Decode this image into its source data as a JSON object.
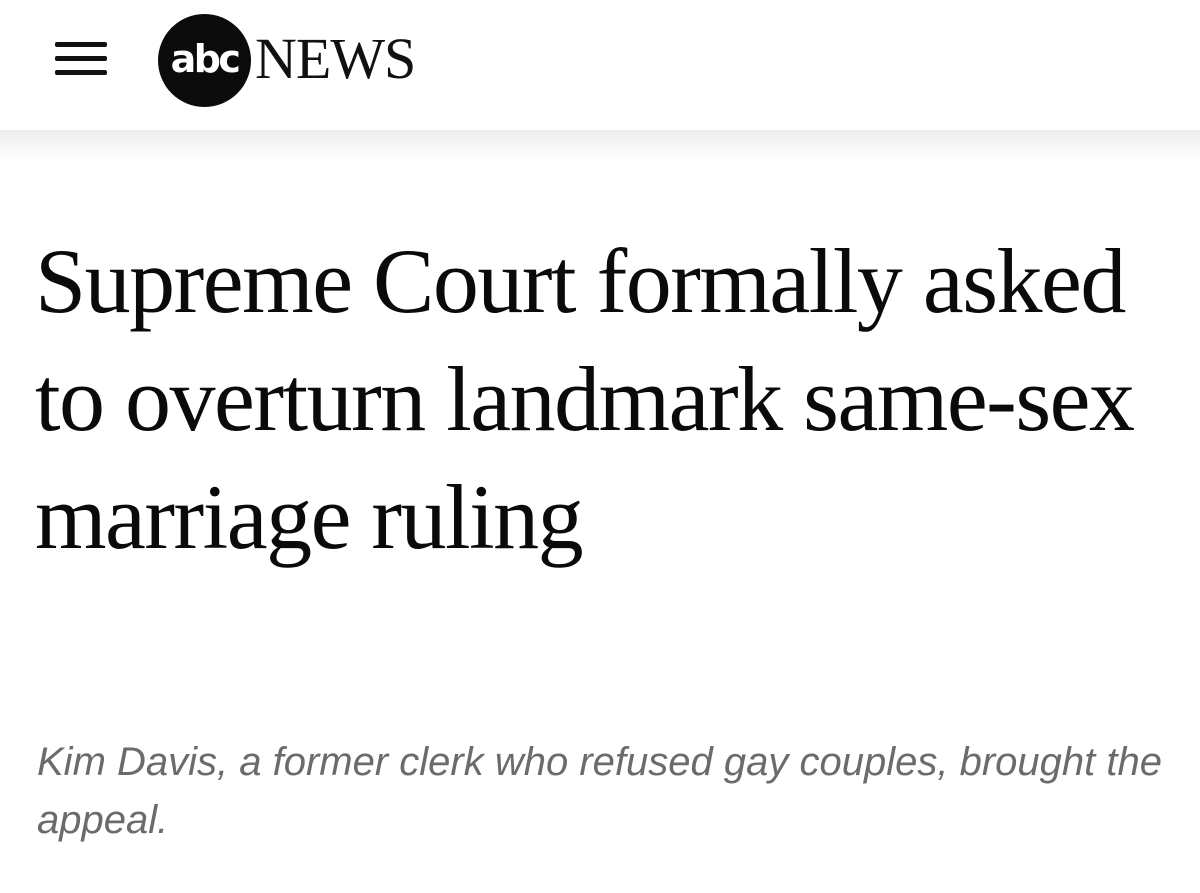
{
  "header": {
    "menu_icon": "hamburger-menu-icon",
    "logo": {
      "mark_text": "abc",
      "wordmark": "NEWS"
    }
  },
  "article": {
    "headline": "Supreme Court formally asked to overturn landmark same-sex marriage ruling",
    "subheadline": "Kim Davis, a former clerk who refused gay couples, brought the appeal."
  }
}
